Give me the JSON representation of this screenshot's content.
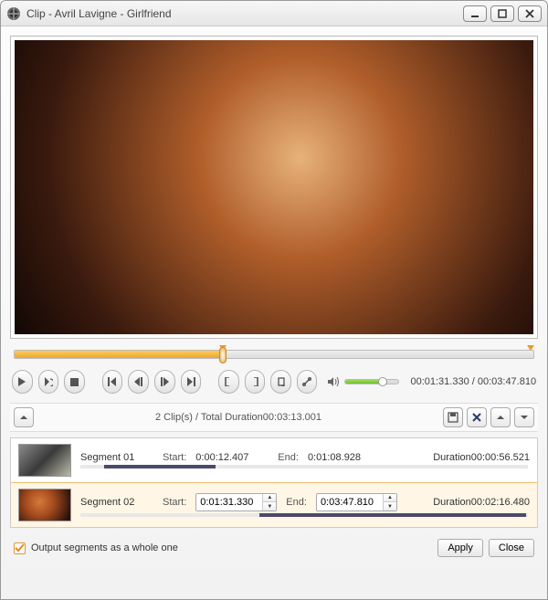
{
  "window": {
    "title": "Clip - Avril Lavigne - Girlfriend"
  },
  "playback": {
    "current_time": "00:01:31.330",
    "total_time": "00:03:47.810",
    "scrubber_percent": 40.1,
    "mark_start_percent": 40.1,
    "mark_end_percent": 99.5,
    "volume_percent": 70
  },
  "summary": {
    "text": "2 Clip(s) / Total Duration00:03:13.001"
  },
  "segments": [
    {
      "name": "Segment 01",
      "start_label": "Start:",
      "start": "0:00:12.407",
      "end_label": "End:",
      "end": "0:01:08.928",
      "duration_label": "Duration",
      "duration": "00:00:56.521",
      "bar_left_pct": 5.4,
      "bar_width_pct": 24.8,
      "selected": false,
      "editable": false
    },
    {
      "name": "Segment 02",
      "start_label": "Start:",
      "start": "0:01:31.330",
      "end_label": "End:",
      "end": "0:03:47.810",
      "duration_label": "Duration",
      "duration": "00:02:16.480",
      "bar_left_pct": 40.1,
      "bar_width_pct": 59.5,
      "selected": true,
      "editable": true
    }
  ],
  "footer": {
    "output_whole_label": "Output segments as a whole one",
    "output_whole_checked": true,
    "apply": "Apply",
    "close": "Close"
  }
}
